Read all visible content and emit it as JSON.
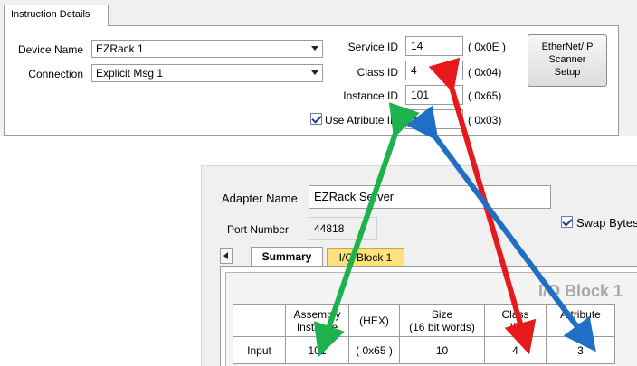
{
  "instruction": {
    "tab_label": "Instruction Details",
    "device_name_label": "Device Name",
    "device_name_value": "EZRack 1",
    "connection_label": "Connection",
    "connection_value": "Explicit Msg 1",
    "service_id_label": "Service ID",
    "service_id_value": "14",
    "service_id_hex": "( 0x0E )",
    "class_id_label": "Class ID",
    "class_id_value": "4",
    "class_id_hex": "( 0x04)",
    "instance_id_label": "Instance ID",
    "instance_id_value": "101",
    "instance_id_hex": "( 0x65)",
    "use_attribute_label": "Use Atribute ID",
    "use_attribute_checked": true,
    "attribute_value": "3",
    "attribute_hex": "( 0x03)",
    "scanner_button_lines": [
      "EtherNet/IP",
      "Scanner",
      "Setup"
    ]
  },
  "adapter": {
    "adapter_name_label": "Adapter Name",
    "adapter_name_value": "EZRack Server",
    "port_number_label": "Port Number",
    "port_number_value": "44818",
    "swap_bytes_label": "Swap Bytes",
    "swap_bytes_checked": true,
    "tabs": [
      "Summary",
      "I/O Block 1"
    ],
    "io_block_title": "I/O Block 1",
    "table": {
      "headers": [
        "",
        [
          "Assembly",
          "Instance"
        ],
        [
          "(HEX)"
        ],
        [
          "Size",
          "(16 bit words)"
        ],
        [
          "Class",
          "ID"
        ],
        [
          "Attribute",
          "ID"
        ]
      ],
      "rows": [
        [
          "Input",
          "101",
          "( 0x65 )",
          "10",
          "4",
          "3"
        ]
      ]
    }
  },
  "arrow_colors": {
    "instance": "#1db24b",
    "class": "#e8191c",
    "attribute": "#1f6fc4"
  }
}
